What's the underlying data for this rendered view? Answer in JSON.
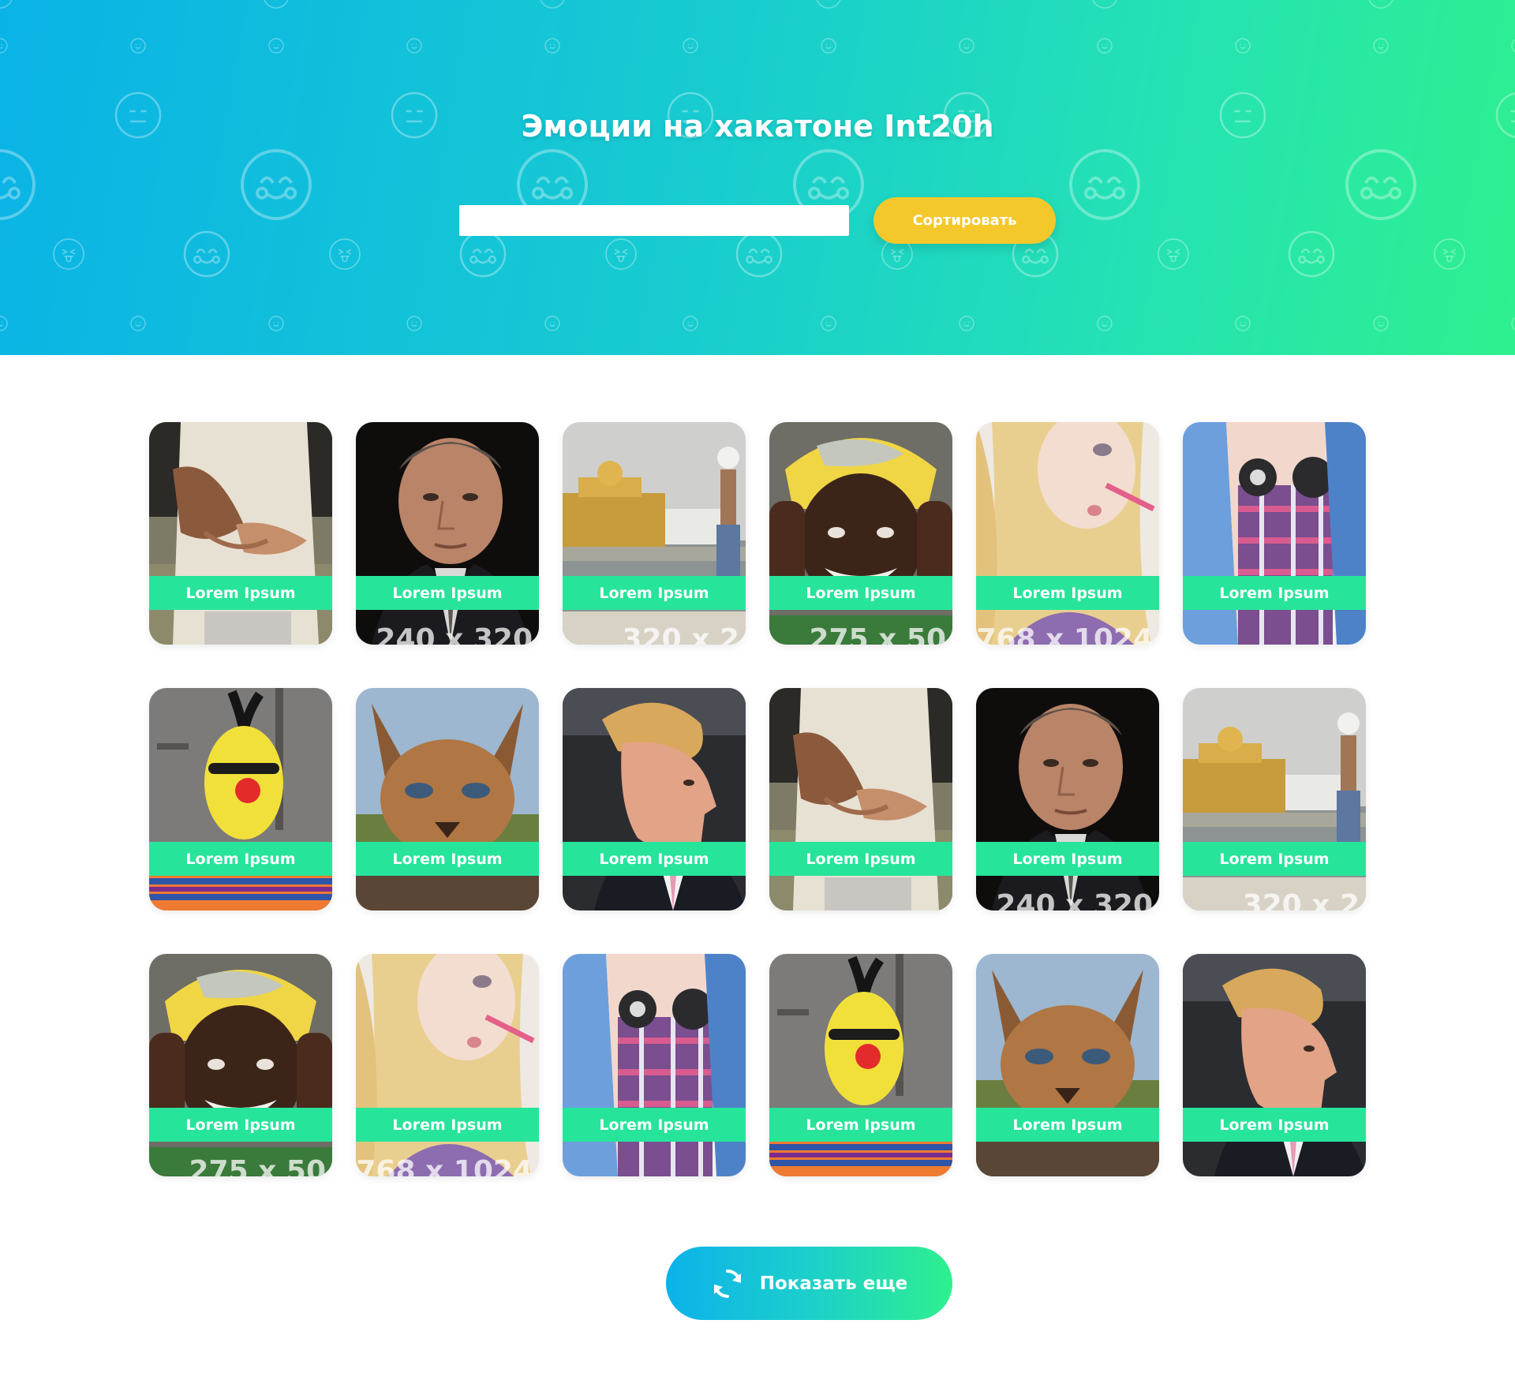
{
  "header": {
    "title": "Эмоции на хакатоне Int20h",
    "search_value": "",
    "sort_label": "Сортировать"
  },
  "gallery": {
    "items": [
      {
        "label": "Lorem Ipsum",
        "size": "",
        "scene": "hands-belly"
      },
      {
        "label": "Lorem Ipsum",
        "size": "240 x 320",
        "scene": "man-portrait"
      },
      {
        "label": "Lorem Ipsum",
        "size": "320 x 2",
        "scene": "golden-temple"
      },
      {
        "label": "Lorem Ipsum",
        "size": "275 x 50",
        "scene": "smiling-woman-headscarf"
      },
      {
        "label": "Lorem Ipsum",
        "size": "768 x 1024",
        "scene": "blonde-woman"
      },
      {
        "label": "Lorem Ipsum",
        "size": "",
        "scene": "headphones-shirt"
      },
      {
        "label": "Lorem Ipsum",
        "size": "",
        "scene": "yellow-puppet"
      },
      {
        "label": "Lorem Ipsum",
        "size": "",
        "scene": "lynx-closeup"
      },
      {
        "label": "Lorem Ipsum",
        "size": "",
        "scene": "man-profile"
      },
      {
        "label": "Lorem Ipsum",
        "size": "",
        "scene": "hands-belly"
      },
      {
        "label": "Lorem Ipsum",
        "size": "240 x 320",
        "scene": "man-portrait"
      },
      {
        "label": "Lorem Ipsum",
        "size": "320 x 2",
        "scene": "golden-temple"
      },
      {
        "label": "Lorem Ipsum",
        "size": "275 x 50",
        "scene": "smiling-woman-headscarf"
      },
      {
        "label": "Lorem Ipsum",
        "size": "768 x 1024",
        "scene": "blonde-woman"
      },
      {
        "label": "Lorem Ipsum",
        "size": "",
        "scene": "headphones-shirt"
      },
      {
        "label": "Lorem Ipsum",
        "size": "",
        "scene": "yellow-puppet"
      },
      {
        "label": "Lorem Ipsum",
        "size": "",
        "scene": "lynx-closeup"
      },
      {
        "label": "Lorem Ipsum",
        "size": "",
        "scene": "man-profile"
      }
    ]
  },
  "load_more": {
    "label": "Показать еще",
    "icon": "refresh-icon"
  },
  "colors": {
    "hero_start": "#0ab3e6",
    "hero_end": "#2ef08e",
    "sort_button": "#f4c82a",
    "card_label": "#26e59b"
  }
}
